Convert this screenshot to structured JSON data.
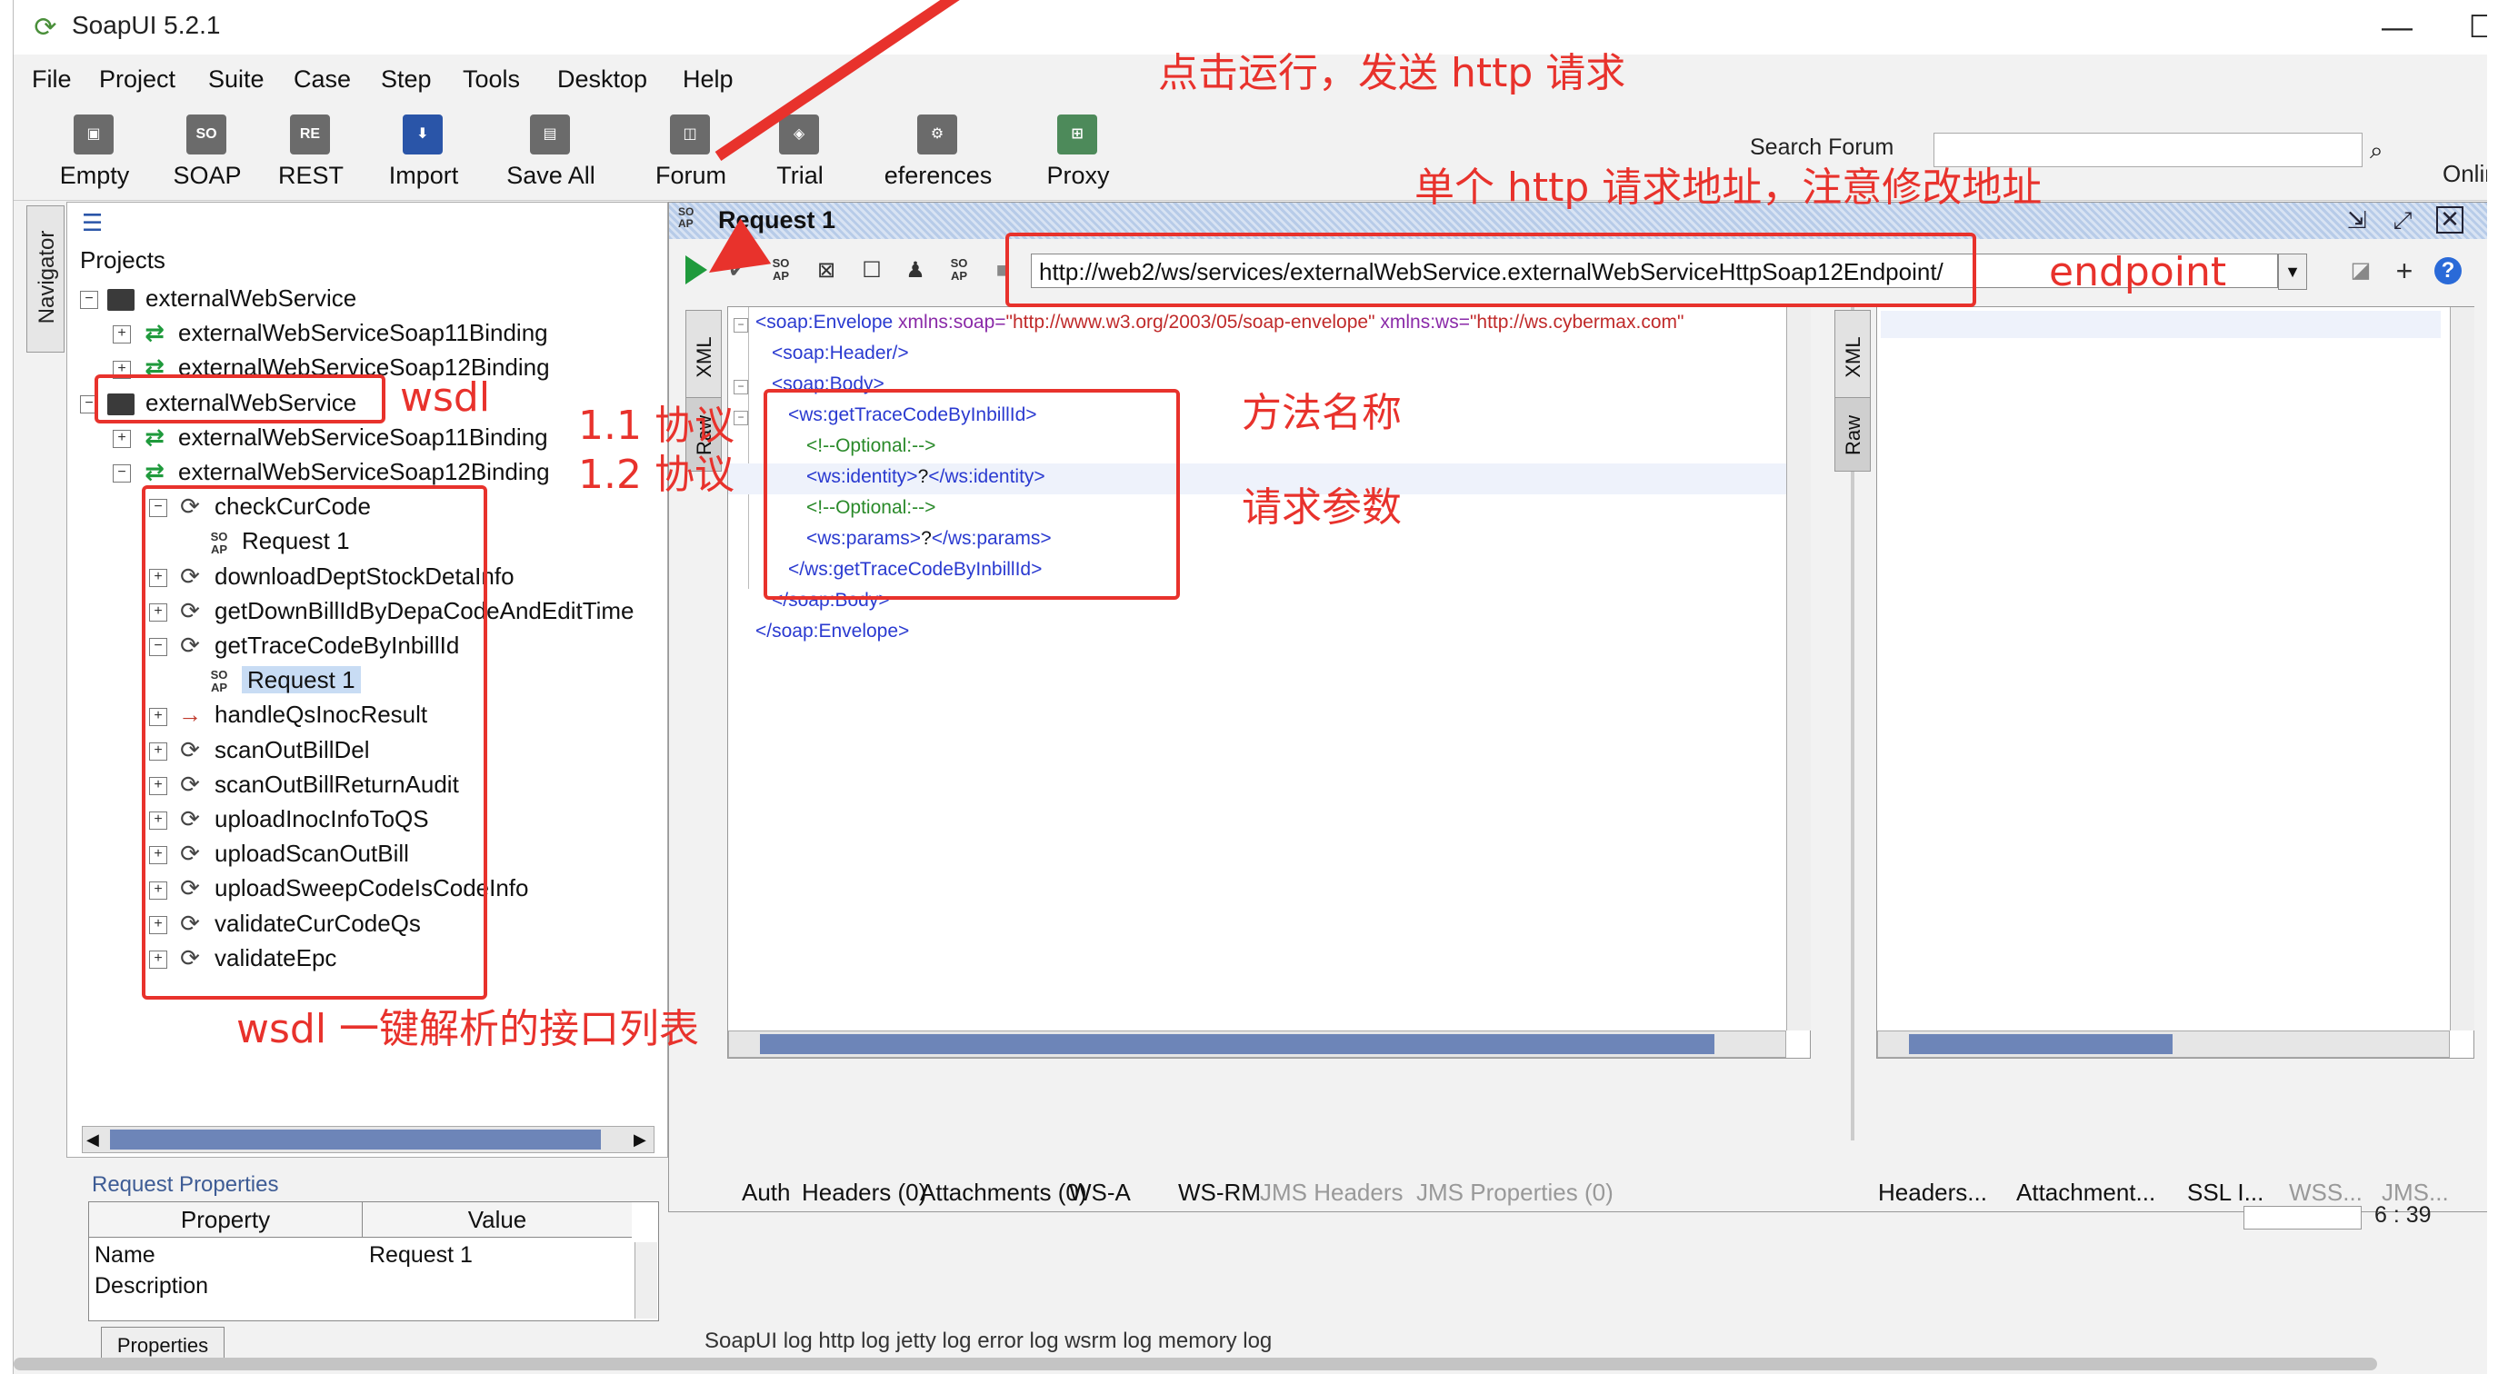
{
  "window": {
    "title": "SoapUI 5.2.1",
    "minimize": "—",
    "maximize": "☐"
  },
  "menu": [
    "File",
    "Project",
    "Suite",
    "Case",
    "Step",
    "Tools",
    "Desktop",
    "Help"
  ],
  "toolbar": {
    "buttons": [
      {
        "label": "Empty",
        "icon": "empty-project-icon"
      },
      {
        "label": "SOAP",
        "icon": "soap-icon"
      },
      {
        "label": "REST",
        "icon": "rest-icon"
      },
      {
        "label": "Import",
        "icon": "import-icon"
      },
      {
        "label": "Save All",
        "icon": "save-all-icon"
      },
      {
        "label": "Forum",
        "icon": "forum-icon"
      },
      {
        "label": "Trial",
        "icon": "trial-icon"
      },
      {
        "label": "eferences",
        "icon": "preferences-icon"
      },
      {
        "label": "Proxy",
        "icon": "proxy-icon"
      }
    ],
    "search_label": "Search Forum",
    "online_label": "Onlin"
  },
  "navigator": {
    "label": "Navigator"
  },
  "tree": {
    "root": "Projects",
    "items": [
      {
        "label": "externalWebService",
        "type": "project",
        "level": 0,
        "expanded": true
      },
      {
        "label": "externalWebServiceSoap11Binding",
        "type": "binding",
        "level": 1
      },
      {
        "label": "externalWebServiceSoap12Binding",
        "type": "binding",
        "level": 1
      },
      {
        "label": "externalWebService",
        "type": "project",
        "level": 0,
        "expanded": true
      },
      {
        "label": "externalWebServiceSoap11Binding",
        "type": "binding",
        "level": 1
      },
      {
        "label": "externalWebServiceSoap12Binding",
        "type": "binding",
        "level": 1,
        "expanded": true
      },
      {
        "label": "checkCurCode",
        "type": "operation",
        "level": 2,
        "expanded": true
      },
      {
        "label": "Request 1",
        "type": "request",
        "level": 3
      },
      {
        "label": "downloadDeptStockDetaInfo",
        "type": "operation",
        "level": 2
      },
      {
        "label": "getDownBillIdByDepaCodeAndEditTime",
        "type": "operation",
        "level": 2
      },
      {
        "label": "getTraceCodeByInbillId",
        "type": "operation",
        "level": 2,
        "expanded": true
      },
      {
        "label": "Request 1",
        "type": "request",
        "level": 3,
        "selected": true
      },
      {
        "label": "handleQsInocResult",
        "type": "operation-oneway",
        "level": 2
      },
      {
        "label": "scanOutBillDel",
        "type": "operation",
        "level": 2
      },
      {
        "label": "scanOutBillReturnAudit",
        "type": "operation",
        "level": 2
      },
      {
        "label": "uploadInocInfoToQS",
        "type": "operation",
        "level": 2
      },
      {
        "label": "uploadScanOutBill",
        "type": "operation",
        "level": 2
      },
      {
        "label": "uploadSweepCodeIsCodeInfo",
        "type": "operation",
        "level": 2
      },
      {
        "label": "validateCurCodeQs",
        "type": "operation",
        "level": 2
      },
      {
        "label": "validateEpc",
        "type": "operation",
        "level": 2
      }
    ]
  },
  "properties": {
    "title": "Request Properties",
    "headers": [
      "Property",
      "Value"
    ],
    "rows": [
      {
        "property": "Name",
        "value": "Request 1"
      },
      {
        "property": "Description",
        "value": ""
      }
    ],
    "tab_label": "Properties"
  },
  "request": {
    "title": "Request 1",
    "endpoint": "http://web2/ws/services/externalWebService.externalWebServiceHttpSoap12Endpoint/",
    "editor_tabs": [
      "XML",
      "Raw"
    ],
    "response_tabs": [
      "XML",
      "Raw"
    ],
    "xml": {
      "l1_open": "<soap:Envelope",
      "l1_attr1": " xmlns:soap=",
      "l1_val1": "\"http://www.w3.org/2003/05/soap-envelope\"",
      "l1_attr2": " xmlns:ws=",
      "l1_val2": "\"http://ws.cybermax.com\"",
      "l2": "<soap:Header/>",
      "l3": "<soap:Body>",
      "l4": "<ws:getTraceCodeByInbillId>",
      "l5": "<!--Optional:-->",
      "l6_open": "<ws:identity>",
      "l6_text": "?",
      "l6_close": "</ws:identity>",
      "l7": "<!--Optional:-->",
      "l8_open": "<ws:params>",
      "l8_text": "?",
      "l8_close": "</ws:params>",
      "l9": "</ws:getTraceCodeByInbillId>",
      "l10": "</soap:Body>",
      "l11": "</soap:Envelope>"
    },
    "bottom_tabs": [
      {
        "label": "Auth",
        "enabled": true
      },
      {
        "label": "Headers (0)",
        "enabled": true
      },
      {
        "label": "Attachments (0)",
        "enabled": true
      },
      {
        "label": "WS-A",
        "enabled": true
      },
      {
        "label": "WS-RM",
        "enabled": true
      },
      {
        "label": "JMS Headers",
        "enabled": false
      },
      {
        "label": "JMS Properties (0)",
        "enabled": false
      }
    ],
    "response_bottom_tabs": [
      {
        "label": "Headers...",
        "enabled": true
      },
      {
        "label": "Attachment...",
        "enabled": true
      },
      {
        "label": "SSL I...",
        "enabled": true
      },
      {
        "label": "WSS...",
        "enabled": false
      },
      {
        "label": "JMS...",
        "enabled": false
      }
    ],
    "cursor_position": "6 : 39"
  },
  "logs": "SoapUI log    http log    jetty log    error log    wsrm log    memory log",
  "annotations": {
    "run": "点击运行，发送 http 请求",
    "address": "单个 http 请求地址，注意修改地址",
    "endpoint": "endpoint",
    "wsdl": "wsdl",
    "soap11": "1.1 协议",
    "soap12": "1.2 协议",
    "method": "方法名称",
    "params": "请求参数",
    "list": "wsdl 一键解析的接口列表"
  },
  "colors": {
    "annotation": "#e8322c",
    "xml_tag": "#2a3ad0",
    "xml_attr": "#8a2aa8",
    "xml_value": "#c02a2a",
    "xml_comment": "#2a8a2a",
    "run_green": "#1f9a3c",
    "selection": "#c8dcf4"
  }
}
